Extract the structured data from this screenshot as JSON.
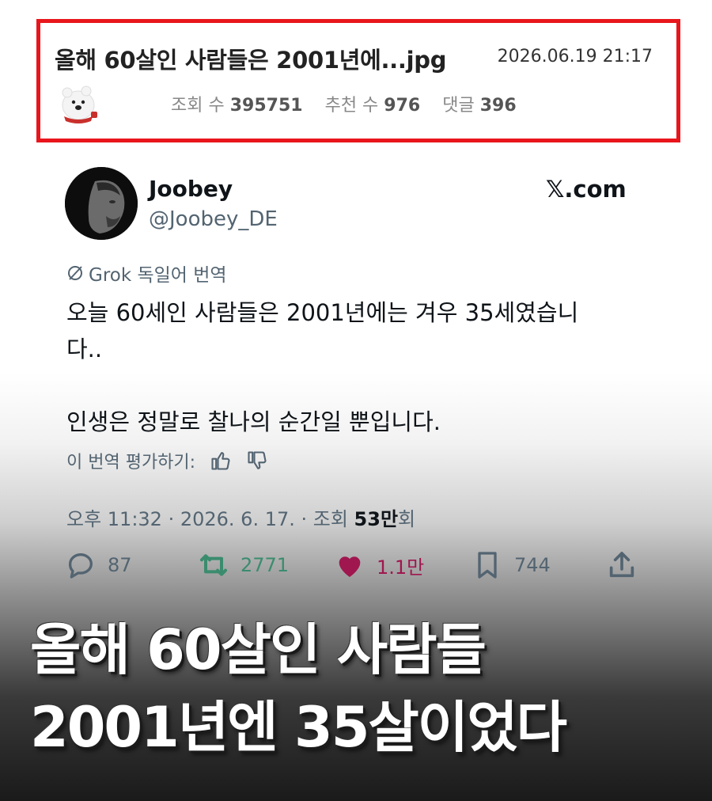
{
  "post": {
    "title": "올해 60살인 사람들은 2001년에...jpg",
    "date": "2026.06.19 21:17",
    "views_label": "조회 수",
    "views_value": "395751",
    "recommend_label": "추천 수",
    "recommend_value": "976",
    "comments_label": "댓글",
    "comments_value": "396"
  },
  "tweet": {
    "name": "Joobey",
    "handle": "@Joobey_DE",
    "source": "𝕏.com",
    "translate_note": "Grok 독일어 번역",
    "text_line1": "오늘 60세인 사람들은 2001년에는 겨우 35세였습니",
    "text_line2": "다..",
    "text_line3": "인생은 정말로 찰나의 순간일 뿐입니다.",
    "rate_label": "이 번역 평가하기:",
    "meta_prefix": "오후 11:32 · 2026. 6. 17. · 조회 ",
    "meta_views": "53만",
    "meta_suffix": "회",
    "replies": "87",
    "retweets": "2771",
    "likes": "1.1만",
    "bookmarks": "744"
  },
  "caption": {
    "line1": "올해 60살인 사람들",
    "line2": "2001년엔 35살이었다"
  },
  "colors": {
    "header_border": "#e8161c",
    "retweet_green": "#3b8c6e",
    "like_pink": "#a0174f",
    "muted_gray": "#536471"
  }
}
